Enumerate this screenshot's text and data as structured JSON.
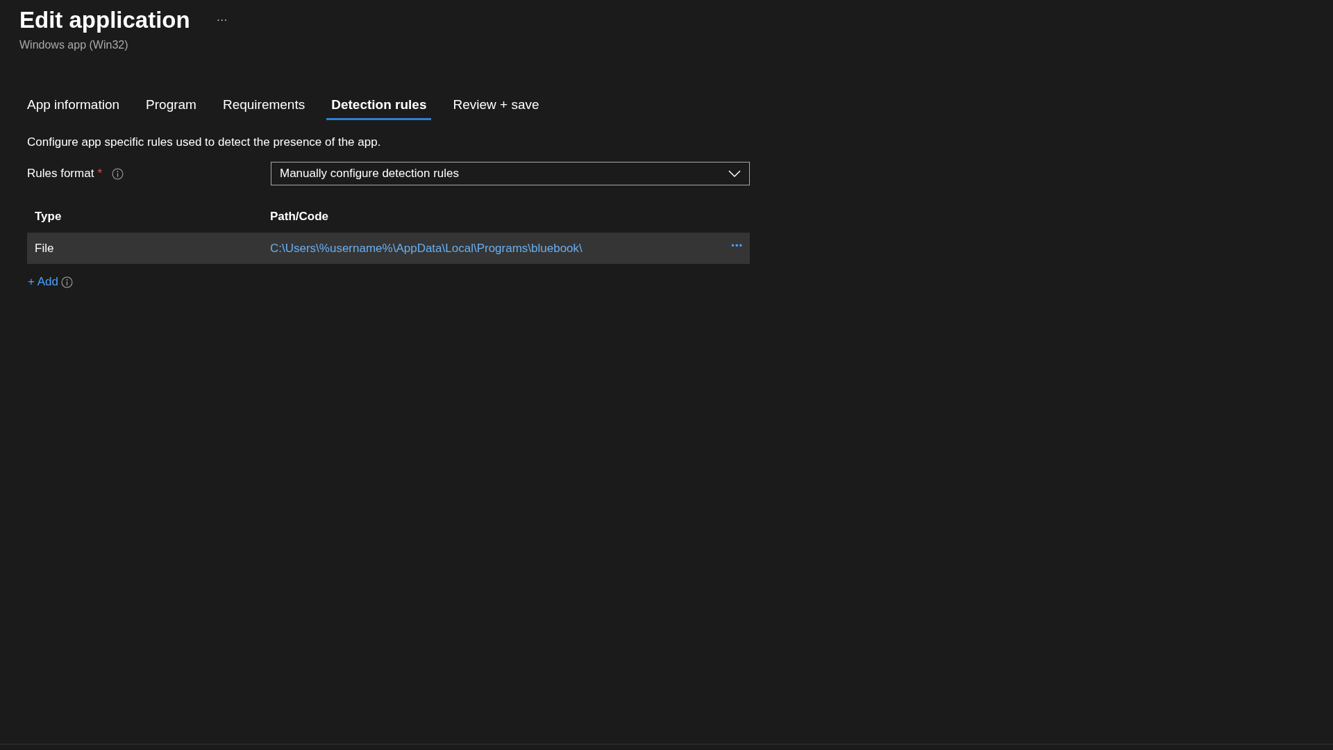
{
  "header": {
    "title": "Edit application",
    "more": "···",
    "subtitle": "Windows app (Win32)"
  },
  "tabs": [
    {
      "label": "App information",
      "selected": false
    },
    {
      "label": "Program",
      "selected": false
    },
    {
      "label": "Requirements",
      "selected": false
    },
    {
      "label": "Detection rules",
      "selected": true
    },
    {
      "label": "Review + save",
      "selected": false
    }
  ],
  "description": "Configure app specific rules used to detect the presence of the app.",
  "rules_format": {
    "label": "Rules format",
    "required": "*",
    "value": "Manually configure detection rules"
  },
  "table": {
    "columns": [
      "Type",
      "Path/Code"
    ],
    "rows": [
      {
        "type": "File",
        "path": "C:\\Users\\%username%\\AppData\\Local\\Programs\\bluebook\\",
        "more": "•••"
      }
    ]
  },
  "add": "+ Add"
}
